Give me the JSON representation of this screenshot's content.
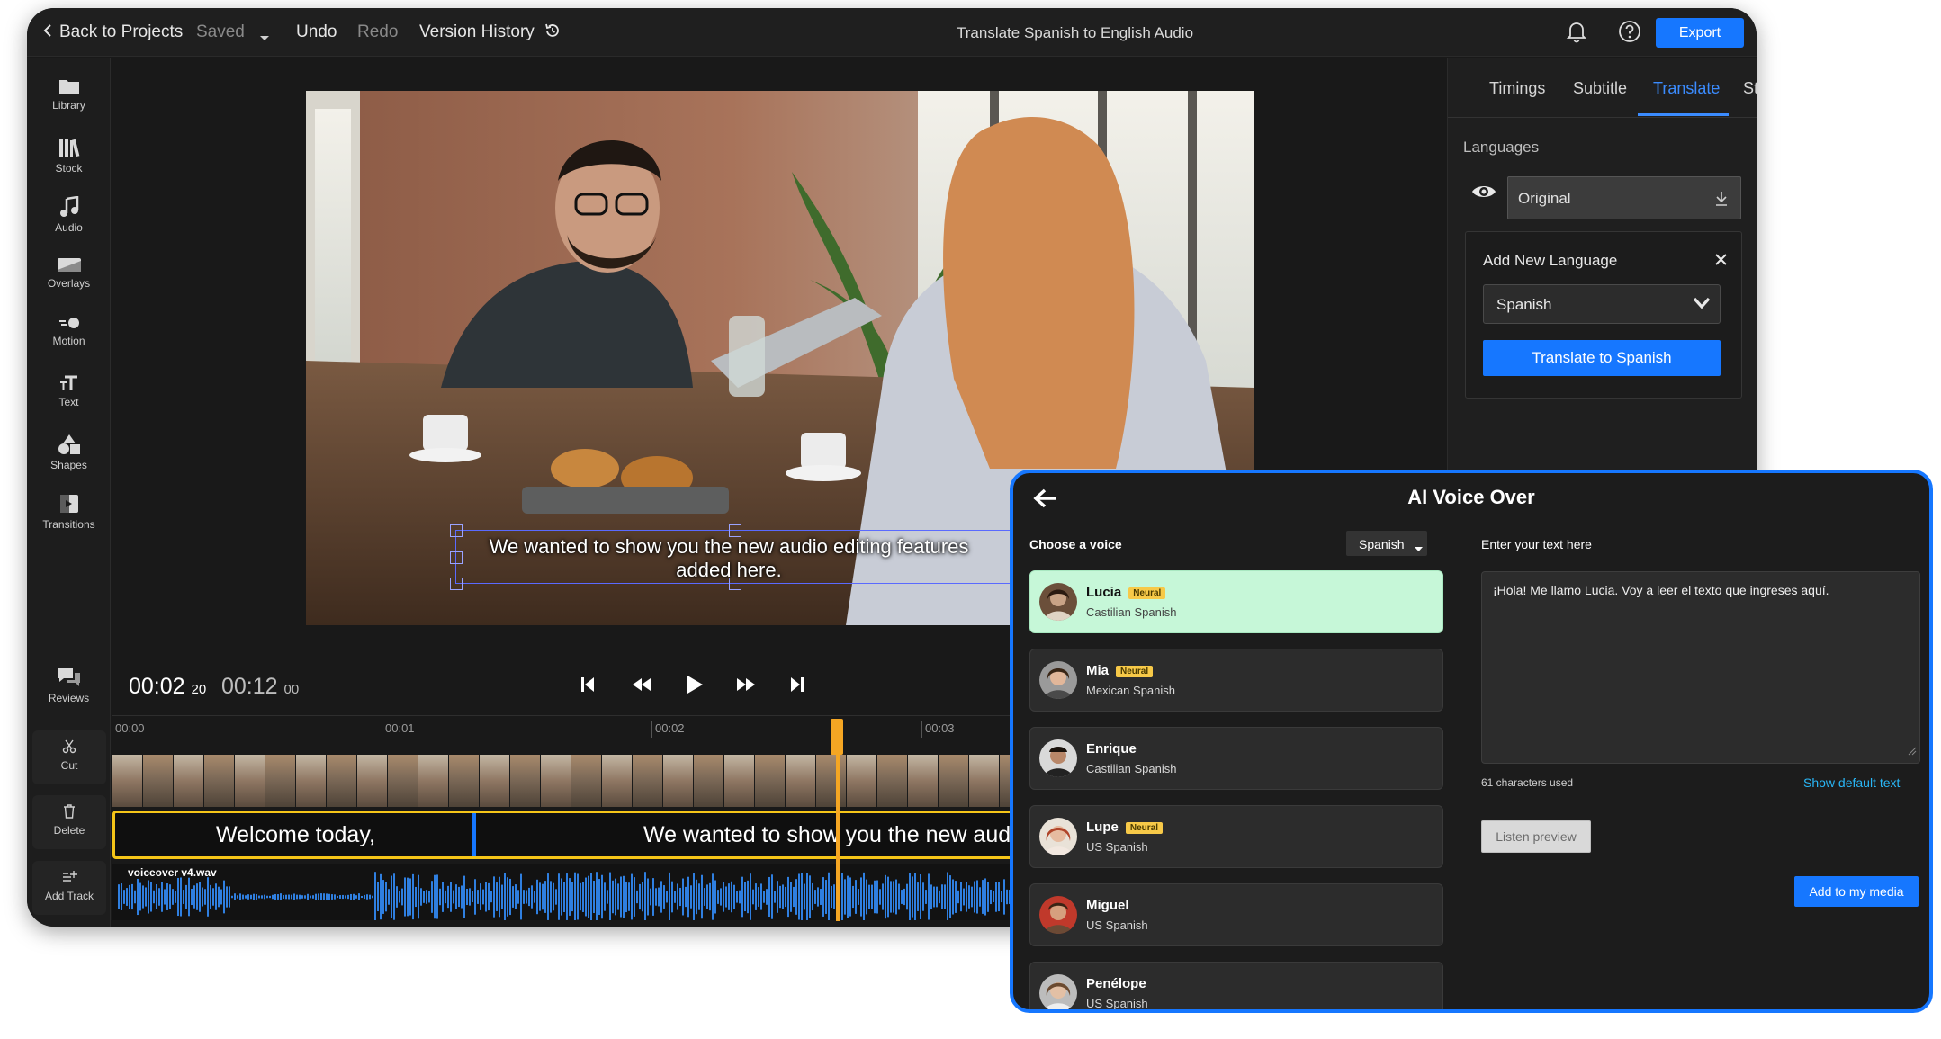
{
  "topbar": {
    "back_label": "Back to Projects",
    "saved_label": "Saved",
    "undo_label": "Undo",
    "redo_label": "Redo",
    "version_history_label": "Version History",
    "project_title": "Translate Spanish to English Audio",
    "export_label": "Export"
  },
  "sidebar": {
    "items": [
      {
        "label": "Library",
        "icon": "folder-icon"
      },
      {
        "label": "Stock",
        "icon": "books-icon"
      },
      {
        "label": "Audio",
        "icon": "music-note-icon"
      },
      {
        "label": "Overlays",
        "icon": "overlay-icon"
      },
      {
        "label": "Motion",
        "icon": "motion-icon"
      },
      {
        "label": "Text",
        "icon": "text-icon"
      },
      {
        "label": "Shapes",
        "icon": "shapes-icon"
      },
      {
        "label": "Transitions",
        "icon": "transitions-icon"
      }
    ],
    "reviews_label": "Reviews",
    "tools": [
      {
        "label": "Cut",
        "icon": "scissors-icon"
      },
      {
        "label": "Delete",
        "icon": "trash-icon"
      },
      {
        "label": "Add Track",
        "icon": "add-track-icon"
      }
    ]
  },
  "preview": {
    "subtitle_text": "We wanted to show you the new audio editing features added here."
  },
  "transport": {
    "current_time": "00:02",
    "current_frames": "20",
    "total_time": "00:12",
    "total_frames": "00"
  },
  "timeline": {
    "ruler_labels": [
      "00:00",
      "00:01",
      "00:02",
      "00:03"
    ],
    "captions": [
      "Welcome today,",
      "We wanted to show you the new audio"
    ],
    "audio_file": "voiceover v4.wav"
  },
  "right_panel": {
    "tabs": [
      "Timings",
      "Subtitle",
      "Translate",
      "Style"
    ],
    "active_tab": "Translate",
    "languages_heading": "Languages",
    "original_label": "Original",
    "add_language_title": "Add New Language",
    "language_selected": "Spanish",
    "translate_button": "Translate to Spanish"
  },
  "voice_over": {
    "title": "AI Voice Over",
    "choose_label": "Choose a voice",
    "language_dropdown": "Spanish",
    "voices": [
      {
        "name": "Lucia",
        "badge": "Neural",
        "accent": "Castilian Spanish"
      },
      {
        "name": "Mia",
        "badge": "Neural",
        "accent": "Mexican Spanish"
      },
      {
        "name": "Enrique",
        "badge": "",
        "accent": "Castilian Spanish"
      },
      {
        "name": "Lupe",
        "badge": "Neural",
        "accent": "US Spanish"
      },
      {
        "name": "Miguel",
        "badge": "",
        "accent": "US Spanish"
      },
      {
        "name": "Penélope",
        "badge": "",
        "accent": "US Spanish"
      }
    ],
    "text_label": "Enter your text here",
    "text_value": "¡Hola! Me llamo Lucia. Voy a leer el texto que ingreses aquí.",
    "char_count": "61 characters used",
    "show_default": "Show default text",
    "listen_preview": "Listen preview",
    "add_to_media": "Add to my media"
  },
  "colors": {
    "accent": "#1677ff",
    "playhead": "#f5a623",
    "caption_border": "#f5c518",
    "waveform": "#2f7fe0",
    "selected_voice": "#c6f7d8"
  }
}
